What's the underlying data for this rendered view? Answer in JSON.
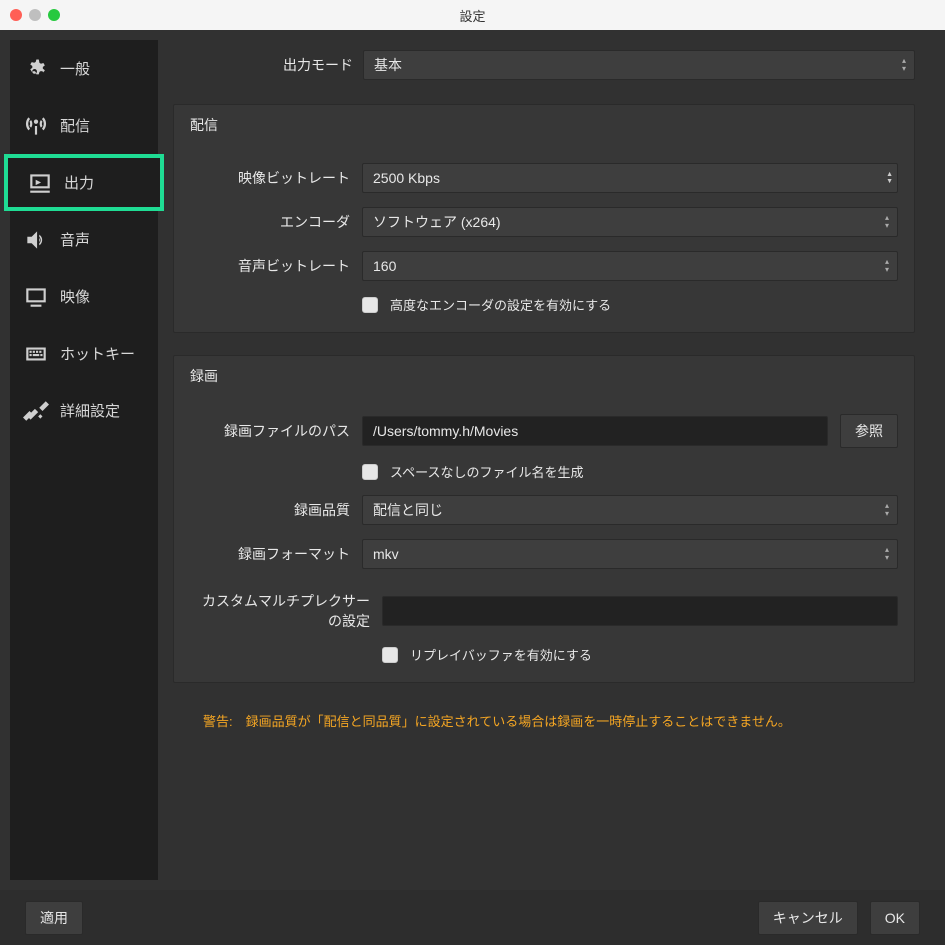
{
  "window": {
    "title": "設定"
  },
  "sidebar": {
    "items": [
      {
        "label": "一般"
      },
      {
        "label": "配信"
      },
      {
        "label": "出力"
      },
      {
        "label": "音声"
      },
      {
        "label": "映像"
      },
      {
        "label": "ホットキー"
      },
      {
        "label": "詳細設定"
      }
    ]
  },
  "top": {
    "output_mode_label": "出力モード",
    "output_mode_value": "基本"
  },
  "stream": {
    "title": "配信",
    "video_bitrate_label": "映像ビットレート",
    "video_bitrate_value": "2500 Kbps",
    "encoder_label": "エンコーダ",
    "encoder_value": "ソフトウェア (x264)",
    "audio_bitrate_label": "音声ビットレート",
    "audio_bitrate_value": "160",
    "advanced_encoder_checkbox": "高度なエンコーダの設定を有効にする"
  },
  "recording": {
    "title": "録画",
    "path_label": "録画ファイルのパス",
    "path_value": "/Users/tommy.h/Movies",
    "browse_label": "参照",
    "no_space_checkbox": "スペースなしのファイル名を生成",
    "quality_label": "録画品質",
    "quality_value": "配信と同じ",
    "format_label": "録画フォーマット",
    "format_value": "mkv",
    "muxer_label": "カスタムマルチプレクサーの設定",
    "muxer_value": "",
    "replay_checkbox": "リプレイバッファを有効にする"
  },
  "warning": "警告:　録画品質が「配信と同品質」に設定されている場合は録画を一時停止することはできません。",
  "footer": {
    "apply": "適用",
    "cancel": "キャンセル",
    "ok": "OK"
  }
}
